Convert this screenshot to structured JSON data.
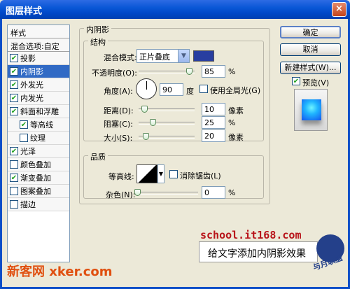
{
  "window": {
    "title": "图层样式",
    "close": "×"
  },
  "sidebar": {
    "header": "样式",
    "blend": "混合选项:自定",
    "items": [
      {
        "label": "投影",
        "checked": true
      },
      {
        "label": "内阴影",
        "checked": true,
        "selected": true
      },
      {
        "label": "外发光",
        "checked": true
      },
      {
        "label": "内发光",
        "checked": true
      },
      {
        "label": "斜面和浮雕",
        "checked": true
      },
      {
        "label": "等高线",
        "checked": true,
        "sub": true
      },
      {
        "label": "纹理",
        "checked": false,
        "sub": true
      },
      {
        "label": "光泽",
        "checked": true
      },
      {
        "label": "颜色叠加",
        "checked": false
      },
      {
        "label": "渐变叠加",
        "checked": true
      },
      {
        "label": "图案叠加",
        "checked": false
      },
      {
        "label": "描边",
        "checked": false
      }
    ]
  },
  "panel": {
    "title": "内阴影",
    "structure": {
      "title": "结构",
      "blend_mode_label": "混合模式:",
      "blend_mode": "正片叠底",
      "blend_color": "#283ea0",
      "opacity_label": "不透明度(O):",
      "opacity": "85",
      "opacity_unit": "%",
      "angle_label": "角度(A):",
      "angle": "90",
      "angle_unit": "度",
      "global_light": "使用全局光(G)",
      "distance_label": "距离(D):",
      "distance": "10",
      "distance_unit": "像素",
      "choke_label": "阻塞(C):",
      "choke": "25",
      "choke_unit": "%",
      "size_label": "大小(S):",
      "size": "20",
      "size_unit": "像素"
    },
    "quality": {
      "title": "品质",
      "contour_label": "等高线:",
      "antialias": "消除锯齿(L)",
      "noise_label": "杂色(N):",
      "noise": "0",
      "noise_unit": "%"
    }
  },
  "buttons": {
    "ok": "确定",
    "cancel": "取消",
    "new_style": "新建样式(W)...",
    "preview": "预览(V)"
  },
  "watermarks": {
    "site": "school.it168.com",
    "caption": "给文字添加内阴影效果",
    "bottom_cn": "新客网",
    "bottom_en": "xker.com",
    "logo": "与月联盟"
  }
}
